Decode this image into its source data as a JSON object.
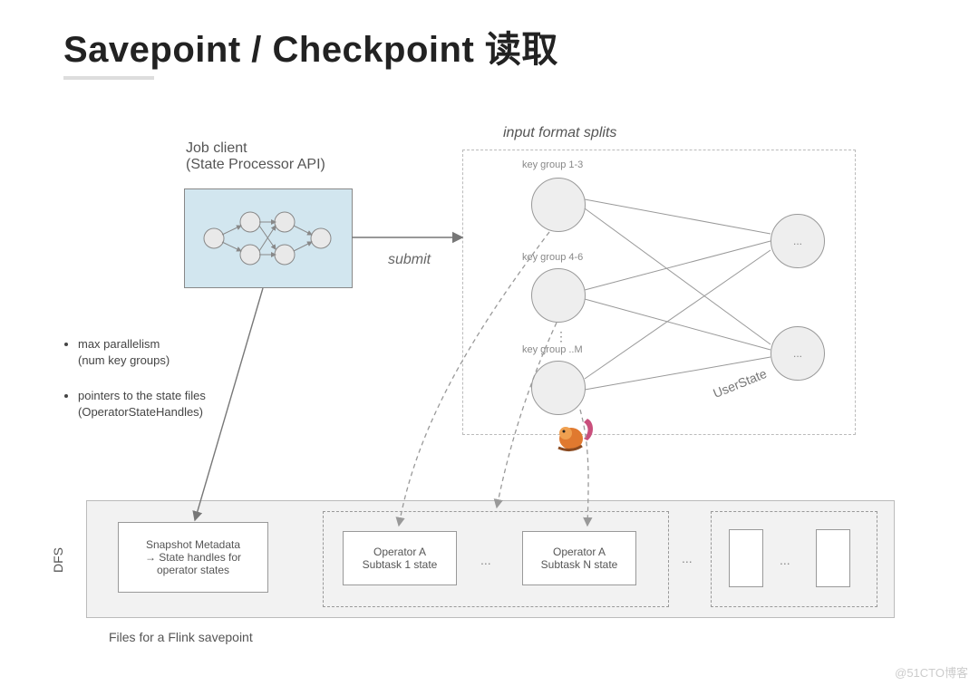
{
  "title": "Savepoint / Checkpoint 读取",
  "job_client": {
    "label_line1": "Job client",
    "label_line2": "(State Processor API)"
  },
  "submit_label": "submit",
  "input_format_splits": {
    "title": "input format splits",
    "key_groups": [
      "key group 1-3",
      "key group 4-6",
      "key group ..M"
    ],
    "user_state_label": "UserState",
    "ellipsis": "...",
    "right_node_text": "..."
  },
  "bullets": [
    {
      "line1": "max parallelism",
      "line2": "(num key groups)"
    },
    {
      "line1": "pointers to the state files",
      "line2": "(OperatorStateHandles)"
    }
  ],
  "dfs": {
    "label": "DFS",
    "snapshot_metadata": {
      "line1": "Snapshot Metadata",
      "line2": "→ State handles for",
      "line3": "operator states"
    },
    "operator_cards": [
      {
        "line1": "Operator A",
        "line2": "Subtask 1 state"
      },
      {
        "line1": "Operator A",
        "line2": "Subtask N state"
      }
    ],
    "ellipsis": "...",
    "files_caption": "Files for a Flink savepoint"
  },
  "watermark": "@51CTO博客"
}
